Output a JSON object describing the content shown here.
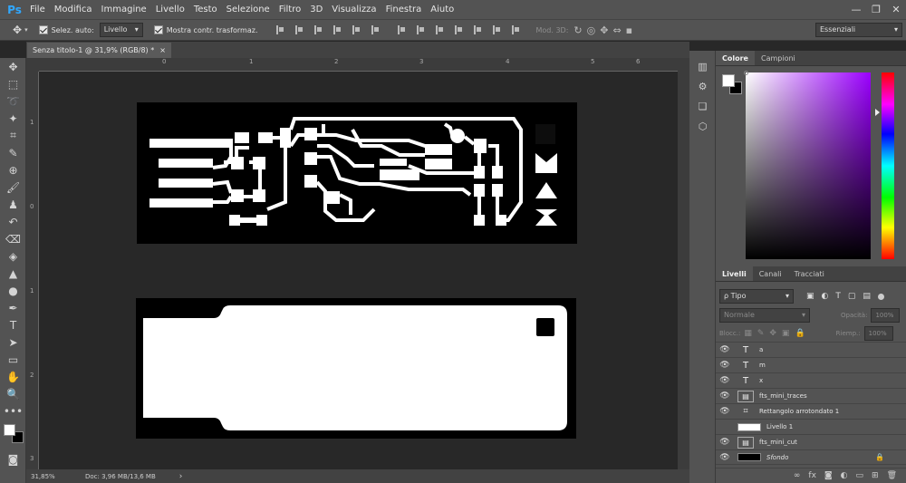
{
  "app": {
    "logo": "Ps"
  },
  "menu": [
    "File",
    "Modifica",
    "Immagine",
    "Livello",
    "Testo",
    "Selezione",
    "Filtro",
    "3D",
    "Visualizza",
    "Finestra",
    "Aiuto"
  ],
  "window_controls": [
    "—",
    "❐",
    "✕"
  ],
  "options": {
    "auto_select_label": "Selez. auto:",
    "auto_select_value": "Livello",
    "show_transform_label": "Mostra contr. trasformaz.",
    "mode3d_label": "Mod. 3D:",
    "workspace": "Essenziali"
  },
  "document": {
    "tab_title": "Senza titolo-1 @ 31,9% (RGB/8) *",
    "close": "×",
    "zoom": "31,85%",
    "doc_info": "Doc: 3,96 MB/13,6 MB"
  },
  "rulers": {
    "h": [
      "0",
      "1",
      "2",
      "3",
      "4",
      "5",
      "6"
    ],
    "v": [
      "1",
      "0",
      "1",
      "2",
      "3"
    ]
  },
  "panels": {
    "color_tabs": [
      "Colore",
      "Campioni"
    ],
    "layers_tabs": [
      "Livelli",
      "Canali",
      "Tracciati"
    ],
    "filter_kind": "ρ Tipo",
    "blend_mode": "Normale",
    "opacity_label": "Opacità:",
    "opacity_value": "100%",
    "lock_label": "Blocc.:",
    "fill_label": "Riemp.:",
    "fill_value": "100%"
  },
  "layers": [
    {
      "name": "a",
      "type": "text",
      "visible": true
    },
    {
      "name": "m",
      "type": "text",
      "visible": true
    },
    {
      "name": "x",
      "type": "text",
      "visible": true
    },
    {
      "name": "fts_mini_traces",
      "type": "smart",
      "visible": true
    },
    {
      "name": "Rettangolo arrotondato 1",
      "type": "shape",
      "visible": true
    },
    {
      "name": "Livello 1",
      "type": "raster",
      "visible": false
    },
    {
      "name": "fts_mini_cut",
      "type": "smart",
      "visible": true
    },
    {
      "name": "Sfondo",
      "type": "background",
      "visible": true,
      "locked": true
    }
  ],
  "layer_footer_icons": [
    "link-icon",
    "fx-icon",
    "mask-icon",
    "adjustment-icon",
    "group-icon",
    "new-layer-icon",
    "trash-icon"
  ]
}
